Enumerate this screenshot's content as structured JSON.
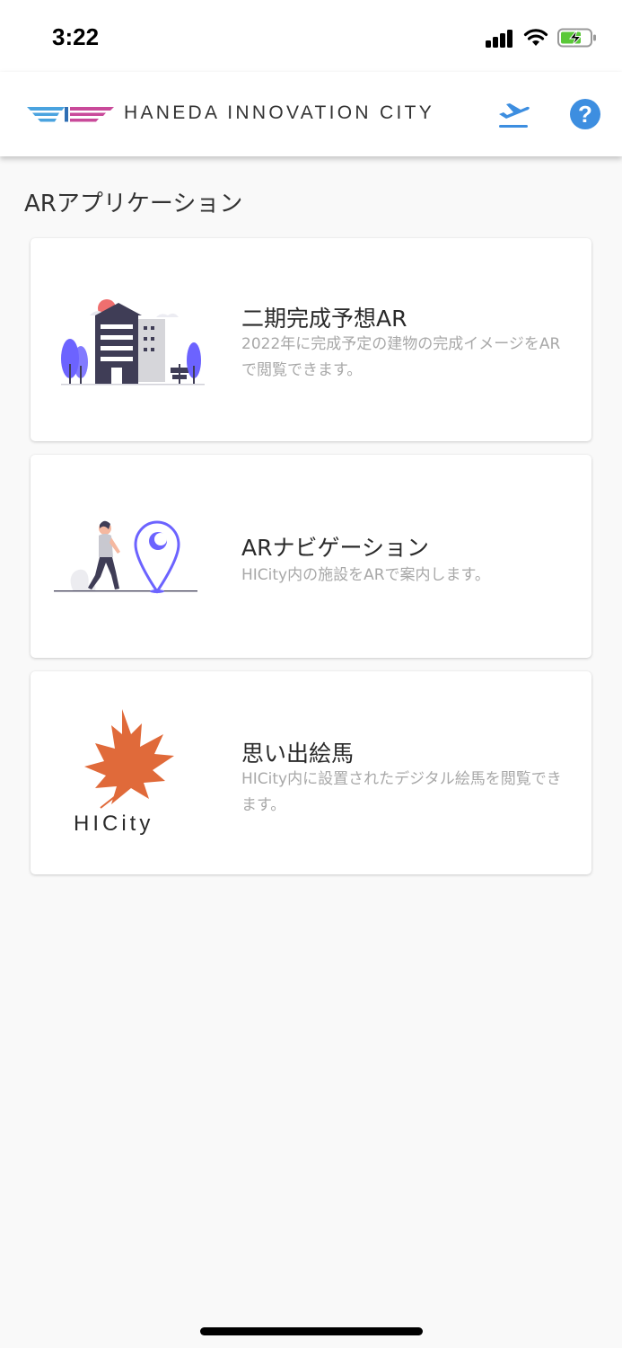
{
  "status_bar": {
    "time": "3:22"
  },
  "header": {
    "brand_name": "HANEDA INNOVATION CITY",
    "help_label": "?"
  },
  "section_title": "ARアプリケーション",
  "cards": [
    {
      "title": "二期完成予想AR",
      "description": "2022年に完成予定の建物の完成イメージをARで閲覧できます。"
    },
    {
      "title": "ARナビゲーション",
      "description": "HICity内の施設をARで案内します。"
    },
    {
      "title": "思い出絵馬",
      "description": "HICity内に設置されたデジタル絵馬を閲覧できます。",
      "logo_text": "HICity"
    }
  ],
  "colors": {
    "accent_blue": "#3d8ee0",
    "illustration_purple": "#6c63ff",
    "maple_orange": "#e06a3a"
  }
}
